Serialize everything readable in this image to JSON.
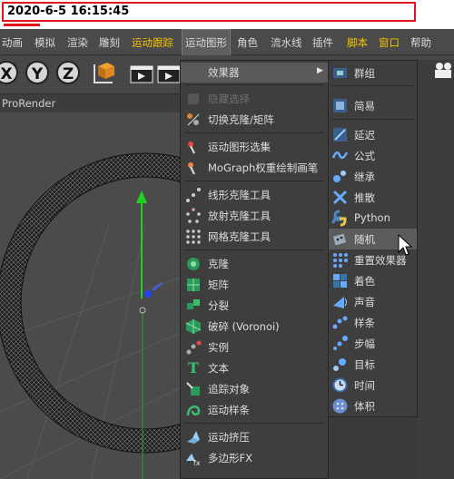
{
  "timestamp": "2020-6-5 16:15:45",
  "menubar": {
    "items": [
      {
        "label": "动画"
      },
      {
        "label": "模拟"
      },
      {
        "label": "渲染"
      },
      {
        "label": "雕刻"
      },
      {
        "label": "运动跟踪"
      },
      {
        "label": "运动图形"
      },
      {
        "label": "角色"
      },
      {
        "label": "流水线"
      },
      {
        "label": "插件"
      },
      {
        "label": "脚本"
      },
      {
        "label": "窗口"
      },
      {
        "label": "帮助"
      }
    ]
  },
  "toolbar": {
    "axis_x": "X",
    "axis_y": "Y",
    "axis_z": "Z"
  },
  "view": {
    "renderer_label": "ProRender"
  },
  "menu": {
    "items": [
      {
        "label": "效果器"
      },
      {
        "label": "隐藏选择"
      },
      {
        "label": "切换克隆/矩阵"
      },
      {
        "label": "运动图形选集"
      },
      {
        "label": "MoGraph权重绘制画笔"
      },
      {
        "label": "线形克隆工具"
      },
      {
        "label": "放射克隆工具"
      },
      {
        "label": "网格克隆工具"
      },
      {
        "label": "克隆"
      },
      {
        "label": "矩阵"
      },
      {
        "label": "分裂"
      },
      {
        "label": "破碎 (Voronoi)"
      },
      {
        "label": "实例"
      },
      {
        "label": "文本"
      },
      {
        "label": "追踪对象"
      },
      {
        "label": "运动样条"
      },
      {
        "label": "运动挤压"
      },
      {
        "label": "多边形FX"
      }
    ]
  },
  "submenu": {
    "items": [
      {
        "label": "群组"
      },
      {
        "label": "简易"
      },
      {
        "label": "延迟"
      },
      {
        "label": "公式"
      },
      {
        "label": "继承"
      },
      {
        "label": "推散"
      },
      {
        "label": "Python"
      },
      {
        "label": "随机"
      },
      {
        "label": "重置效果器"
      },
      {
        "label": "着色"
      },
      {
        "label": "声音"
      },
      {
        "label": "样条"
      },
      {
        "label": "步幅"
      },
      {
        "label": "目标"
      },
      {
        "label": "时间"
      },
      {
        "label": "体积"
      }
    ]
  },
  "colors": {
    "accent_yellow": "#f2c200",
    "stamp_red": "#e0141e",
    "menu_bg": "#3e3e3e"
  }
}
